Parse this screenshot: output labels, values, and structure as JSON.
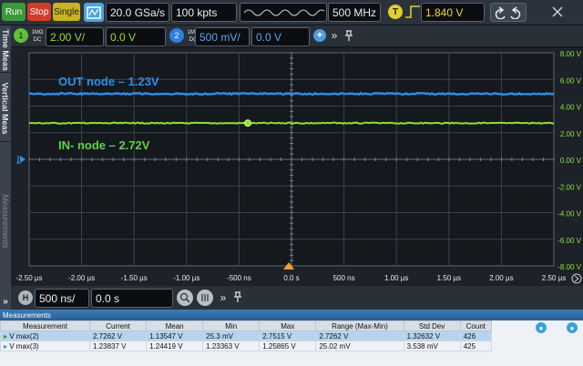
{
  "toolbar": {
    "run_label": "Run",
    "stop_label": "Stop",
    "single_label": "Single",
    "sample_rate": "20.0 GSa/s",
    "memory_depth": "100 kpts",
    "bandwidth": "500 MHz",
    "trigger_icon_letter": "T",
    "trigger_level": "1.840 V"
  },
  "channels": {
    "ch1": {
      "coupling_top": "1MΩ",
      "coupling_bottom": "DC",
      "scale": "2.00 V/",
      "offset": "0.0 V",
      "color": "#7bd33a"
    },
    "ch2": {
      "coupling_top": "1MΩ",
      "coupling_bottom": "DC",
      "scale": "500 mV/",
      "offset": "0.0 V",
      "color": "#2f7fe0"
    }
  },
  "side_tabs": [
    "Time Meas",
    "Vertical Meas",
    "Measurements"
  ],
  "graticule": {
    "y_ticks": [
      "8.00 V",
      "6.00 V",
      "4.00 V",
      "2.00 V",
      "0.00 V",
      "-2.00 V",
      "-4.00 V",
      "-6.00 V",
      "-8.00 V"
    ],
    "x_ticks": [
      "-2.50 µs",
      "-2.00 µs",
      "-1.50 µs",
      "-1.00 µs",
      "-500 ns",
      "0.0 s",
      "500 ns",
      "1.00 µs",
      "1.50 µs",
      "2.00 µs",
      "2.50 µs"
    ]
  },
  "annotations": {
    "out_node": "OUT node – 1.23V",
    "in_node": "IN- node – 2.72V"
  },
  "traces": {
    "out_level_v": 4.92,
    "in_level_v": 2.72,
    "out_color": "#2f8fe8",
    "in_color": "#8ee03a"
  },
  "horizontal": {
    "icon_letter": "H",
    "time_scale": "500 ns/",
    "delay": "0.0 s"
  },
  "measurements": {
    "title": "Measurements",
    "columns": [
      "Measurement",
      "Current",
      "Mean",
      "Min",
      "Max",
      "Range (Max-Min)",
      "Std Dev",
      "Count"
    ],
    "rows": [
      [
        "V max(2)",
        "2.7262 V",
        "1.13547 V",
        "25.3 mV",
        "2.7515 V",
        "2.7262 V",
        "1.32632 V",
        "426"
      ],
      [
        "V max(3)",
        "1.23837 V",
        "1.24419 V",
        "1.23363 V",
        "1.25865 V",
        "25.02 mV",
        "3.538 mV",
        "425"
      ]
    ]
  }
}
